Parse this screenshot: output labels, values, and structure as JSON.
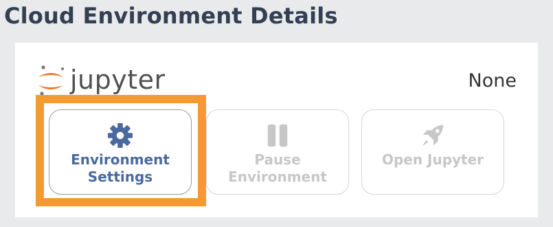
{
  "page": {
    "title": "Cloud Environment Details"
  },
  "card": {
    "brand_name": "jupyter",
    "brand_icon": "jupyter-logo",
    "status": "None"
  },
  "actions": [
    {
      "label": "Environment Settings",
      "icon": "gear-icon",
      "enabled": true,
      "highlighted": true
    },
    {
      "label": "Pause Environment",
      "icon": "pause-icon",
      "enabled": false
    },
    {
      "label": "Open Jupyter",
      "icon": "rocket-icon",
      "enabled": false
    }
  ],
  "colors": {
    "active": "#4a6a9d",
    "disabled": "#c7c7c7",
    "highlight": "#f39a33",
    "background": "#e9eaec",
    "title": "#333f52"
  }
}
